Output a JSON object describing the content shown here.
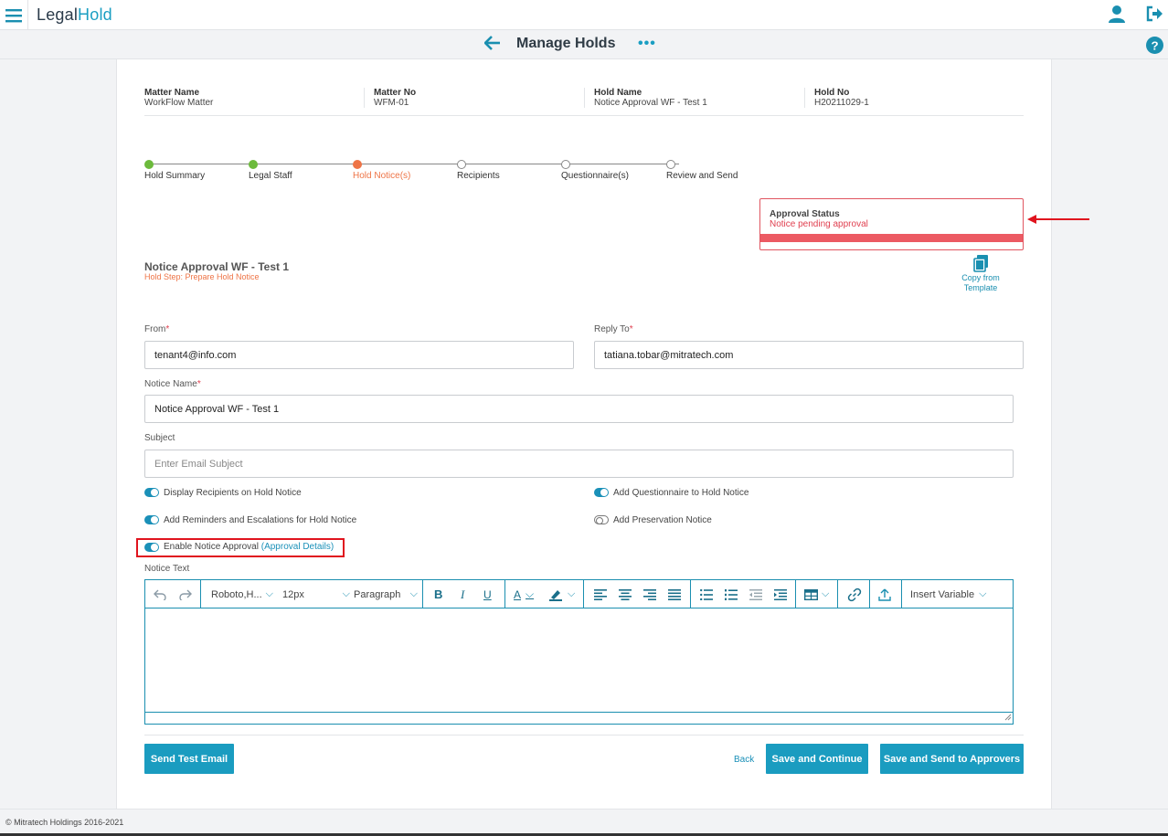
{
  "app": {
    "logo_part1": "Legal",
    "logo_part2": "Hold"
  },
  "header": {
    "title": "Manage Holds",
    "more": "•••"
  },
  "matter": [
    {
      "label": "Matter Name",
      "value": "WorkFlow Matter"
    },
    {
      "label": "Matter No",
      "value": "WFM-01"
    },
    {
      "label": "Hold Name",
      "value": "Notice Approval WF - Test 1"
    },
    {
      "label": "Hold No",
      "value": "H20211029-1"
    }
  ],
  "stepper": {
    "steps": [
      {
        "label": "Hold Summary",
        "state": "done"
      },
      {
        "label": "Legal Staff",
        "state": "done"
      },
      {
        "label": "Hold Notice(s)",
        "state": "current"
      },
      {
        "label": "Recipients",
        "state": "pending"
      },
      {
        "label": "Questionnaire(s)",
        "state": "pending"
      },
      {
        "label": "Review and Send",
        "state": "pending"
      }
    ]
  },
  "approval": {
    "title": "Approval Status",
    "status": "Notice pending approval"
  },
  "notice": {
    "title": "Notice Approval WF - Test 1",
    "step": "Hold Step: Prepare Hold Notice"
  },
  "copy_template": {
    "line1": "Copy from",
    "line2": "Template"
  },
  "form": {
    "from_label": "From",
    "from_value": "tenant4@info.com",
    "reply_label": "Reply To",
    "reply_value": "tatiana.tobar@mitratech.com",
    "notice_name_label": "Notice Name",
    "notice_name_value": "Notice Approval WF - Test 1",
    "subject_label": "Subject",
    "subject_placeholder": "Enter Email Subject",
    "required_mark": "*"
  },
  "toggles": {
    "display_recipients": "Display Recipients on Hold Notice",
    "add_questionnaire": "Add Questionnaire to Hold Notice",
    "add_reminders": "Add Reminders and Escalations for Hold Notice",
    "add_preservation": "Add Preservation Notice",
    "enable_approval": "Enable Notice Approval",
    "approval_details": "(Approval Details)"
  },
  "editor": {
    "label": "Notice Text",
    "font": "Roboto,H...",
    "size": "12px",
    "block": "Paragraph",
    "insert_variable": "Insert Variable"
  },
  "actions": {
    "send_test": "Send Test Email",
    "back": "Back",
    "save_continue": "Save and Continue",
    "save_send": "Save and Send to Approvers"
  },
  "footer": {
    "copyright": "© Mitratech Holdings 2016-2021"
  },
  "colors": {
    "accent": "#1a9cc0",
    "done": "#6cba3c",
    "current": "#ee7446",
    "alert": "#ec5a63"
  }
}
